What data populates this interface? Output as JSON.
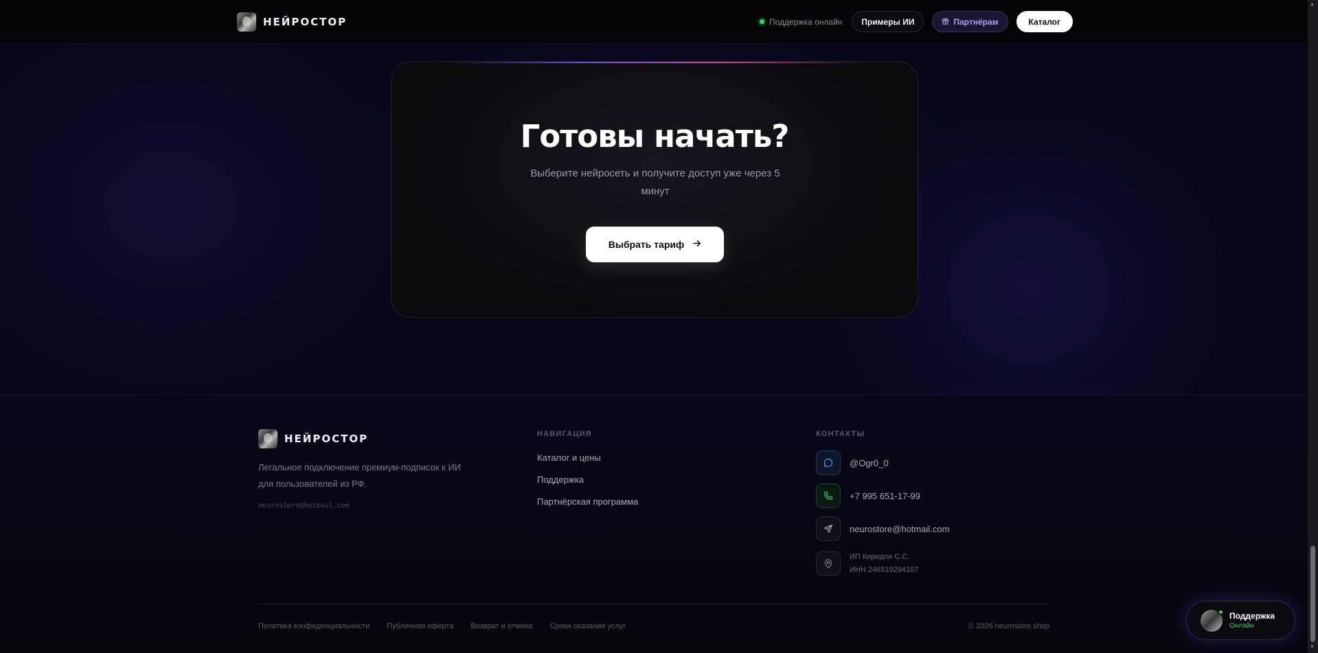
{
  "header": {
    "brand": "НЕЙРОСТОР",
    "support_status": "Поддержка онлайн",
    "examples_label": "Примеры ИИ",
    "partners_label": "Партнёрам",
    "catalog_label": "Каталог"
  },
  "cta": {
    "title": "Готовы начать?",
    "subtitle": "Выберите нейросеть и получите доступ уже через 5 минут",
    "button_label": "Выбрать тариф"
  },
  "footer": {
    "brand": "НЕЙРОСТОР",
    "description": "Легальное подключение премиум-подписок к ИИ для пользователей из РФ.",
    "email": "neurostore@hotmail.com",
    "navigation": {
      "heading": "НАВИГАЦИЯ",
      "links": [
        "Каталог и цены",
        "Поддержка",
        "Партнёрская программа"
      ]
    },
    "contacts": {
      "heading": "КОНТАКТЫ",
      "telegram": "@Ogr0_0",
      "phone": "+7 995 651-17-99",
      "email": "neurostore@hotmail.com",
      "legal_name": "ИП Киридон С.С.",
      "inn": "ИНН 246519294107"
    },
    "legal_links": [
      "Политика конфиденциальности",
      "Публичная оферта",
      "Возврат и отмена",
      "Сроки оказания услуг"
    ],
    "copyright": "© 2026 neurostore.shop"
  },
  "support_widget": {
    "title": "Поддержка",
    "status": "Онлайн"
  },
  "colors": {
    "accent_green": "#2fd46a",
    "accent_purple": "#b59cf5",
    "telegram_blue": "#4f93ef"
  },
  "icons": {
    "telegram": "chat-bubble-icon",
    "phone": "phone-icon",
    "email": "send-icon",
    "address": "map-pin-icon",
    "partners": "gift-icon",
    "cta": "arrow-right-icon"
  }
}
